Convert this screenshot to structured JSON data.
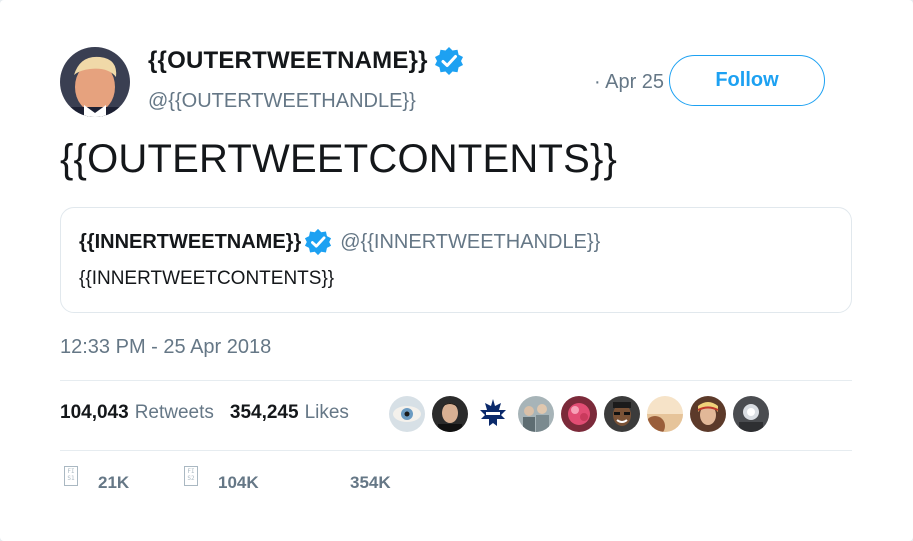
{
  "outer_tweet": {
    "name": "{{OUTERTWEETNAME}}",
    "handle": "@{{OUTERTWEETHANDLE}}",
    "date": "· Apr 25",
    "follow_label": "Follow",
    "contents": "{{OUTERTWEETCONTENTS}}"
  },
  "quoted_tweet": {
    "name": "{{INNERTWEETNAME}}",
    "handle": "@{{INNERTWEETHANDLE}}",
    "contents": "{{INNERTWEETCONTENTS}}"
  },
  "meta": {
    "timestamp": "12:33 PM - 25 Apr 2018",
    "retweets_count": "104,043",
    "retweets_label": "Retweets",
    "likes_count": "354,245",
    "likes_label": "Likes"
  },
  "likers": [
    {
      "icon": "eye-avatar",
      "color": "#b9c9d6"
    },
    {
      "icon": "man-avatar",
      "color": "#2b2b2b"
    },
    {
      "icon": "maple-leaf-avatar",
      "color": "#0b2a6b"
    },
    {
      "icon": "group-avatar",
      "color": "#8a9ba1"
    },
    {
      "icon": "flower-avatar",
      "color": "#d9506e"
    },
    {
      "icon": "smiling-man-avatar",
      "color": "#4a3b2d"
    },
    {
      "icon": "sunset-avatar",
      "color": "#e8c9a3"
    },
    {
      "icon": "woman-avatar",
      "color": "#c98a5a"
    },
    {
      "icon": "light-avatar",
      "color": "#55575a"
    }
  ],
  "actions": {
    "reply_count": "21K",
    "retweet_count": "104K",
    "like_count": "354K",
    "reply_icon_text": "FI S1",
    "retweet_icon_text": "FI S2"
  },
  "colors": {
    "accent": "#1da1f2",
    "verified": "#1da1f2",
    "secondary_text": "#657786"
  }
}
